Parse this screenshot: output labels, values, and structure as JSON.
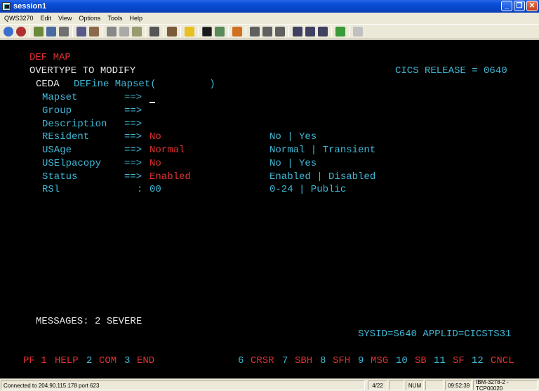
{
  "window": {
    "title": "session1"
  },
  "menu": [
    "QWS3270",
    "Edit",
    "View",
    "Options",
    "Tools",
    "Help"
  ],
  "terminal": {
    "row1": "DEF MAP",
    "row2_left": "OVERTYPE TO MODIFY",
    "row2_right": "CICS RELEASE = 0640",
    "row3_ceda": "CEDA",
    "row3_cmd": "DEFine Mapset(         )",
    "fields": [
      {
        "label": "Mapset",
        "arrow": "==>",
        "value": "",
        "options": ""
      },
      {
        "label": "Group",
        "arrow": "==>",
        "value": "",
        "options": ""
      },
      {
        "label": "Description",
        "arrow": "==>",
        "value": "",
        "options": ""
      },
      {
        "label": "REsident",
        "arrow": "==>",
        "value": "No",
        "options": "No | Yes"
      },
      {
        "label": "USAge",
        "arrow": "==>",
        "value": "Normal",
        "options": "Normal | Transient"
      },
      {
        "label": "USElpacopy",
        "arrow": "==>",
        "value": "No",
        "options": "No | Yes"
      },
      {
        "label": "Status",
        "arrow": "==>",
        "value": "Enabled",
        "options": "Enabled | Disabled"
      },
      {
        "label": "RSl",
        "arrow": ":",
        "value": "00",
        "options": "0-24 | Public"
      }
    ],
    "messages": "MESSAGES: 2 SEVERE",
    "sysid": "SYSID=S640 APPLID=CICSTS31",
    "pfkeys": [
      {
        "num": "PF 1",
        "label": "HELP"
      },
      {
        "num": "2",
        "label": "COM"
      },
      {
        "num": "3",
        "label": "END"
      },
      {
        "num": "6",
        "label": "CRSR"
      },
      {
        "num": "7",
        "label": "SBH"
      },
      {
        "num": "8",
        "label": "SFH"
      },
      {
        "num": "9",
        "label": "MSG"
      },
      {
        "num": "10",
        "label": "SB"
      },
      {
        "num": "11",
        "label": "SF"
      },
      {
        "num": "12",
        "label": "CNCL"
      }
    ]
  },
  "status": {
    "connection": "Connected to 204.90.115.178 port 623",
    "cursor_pos": "4/22",
    "num": "NUM",
    "time": "09:52:39",
    "model": "IBM-3278-2 - TCP00020"
  },
  "colors": {
    "red": "#e03030",
    "cyan": "#41b8d6",
    "white": "#e6e6e6",
    "terminal_bg": "#000000"
  }
}
